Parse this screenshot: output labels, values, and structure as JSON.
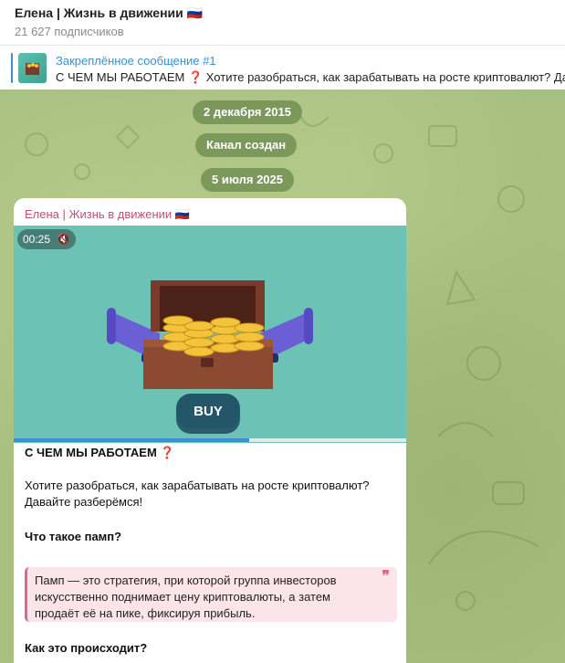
{
  "header": {
    "title": "Елена | Жизнь в движении 🇷🇺",
    "subscribers": "21 627 подписчиков"
  },
  "pinned": {
    "label": "Закреплённое сообщение #1",
    "text": "С ЧЕМ МЫ РАБОТАЕМ ❓  Хотите разобраться, как зарабатывать на росте криптовалют? Давайте разберёмся!"
  },
  "chat": {
    "service": [
      "2 декабря 2015",
      "Канал создан",
      "5 июля 2025"
    ],
    "message": {
      "author": "Елена | Жизнь в движении 🇷🇺",
      "video_time": "00:25",
      "video_progress": 0.6,
      "button_label": "BUY",
      "heading": "С ЧЕМ МЫ РАБОТАЕМ ❓",
      "line1": "Хотите разобраться, как зарабатывать на росте криптовалют?",
      "line2": "Давайте разберёмся!",
      "q1": "Что такое памп?",
      "quote_line1": "Памп — это стратегия, при которой группа инвесторов",
      "quote_line2": "искусственно поднимает цену криптовалюты, а затем",
      "quote_line3": "продаёт её на пике, фиксируя прибыль.",
      "q2": "Как это происходит?"
    }
  },
  "colors": {
    "accent": "#3a8fd6",
    "author": "#c0507a",
    "chat_bg": "#a7bf7f",
    "quote_border": "#d96a8a"
  },
  "icons": [
    "mute-icon",
    "pin-thumbnail",
    "megaphone-icon",
    "treasure-chest-image"
  ]
}
